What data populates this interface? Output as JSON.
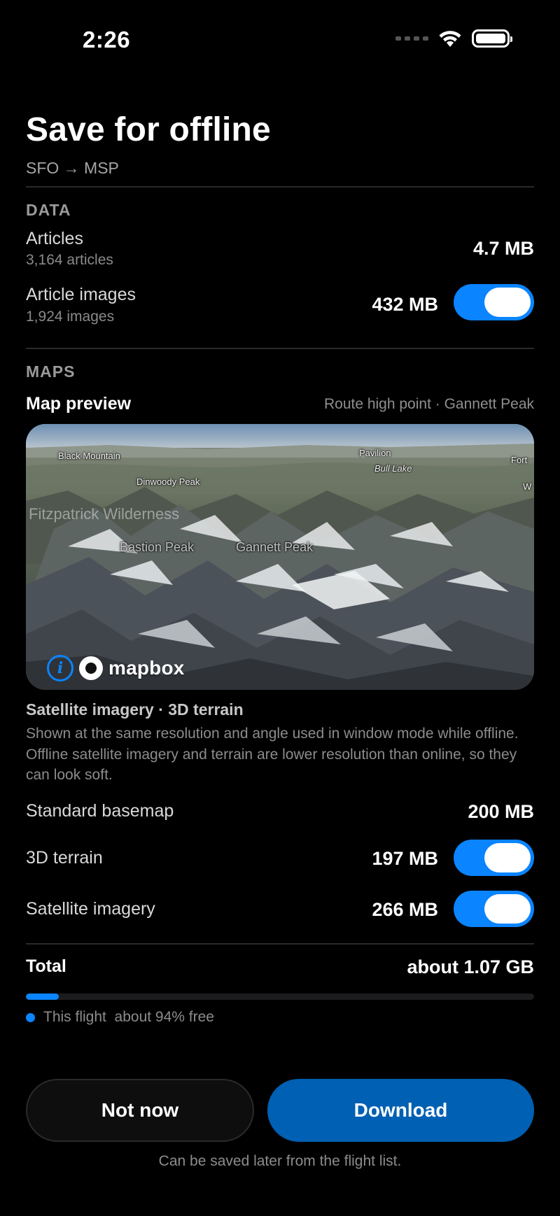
{
  "status_bar": {
    "time": "2:26",
    "icons": [
      "cellular-signal-icon",
      "wifi-icon",
      "battery-icon"
    ]
  },
  "header": {
    "title": "Save for offline",
    "route": "SFO → MSP"
  },
  "data_section": {
    "label": "DATA",
    "articles": {
      "title": "Articles",
      "subtitle": "3,164 articles",
      "size": "4.7 MB"
    },
    "article_images": {
      "title": "Article images",
      "subtitle": "1,924 images",
      "size": "432 MB",
      "enabled": true
    }
  },
  "maps_section": {
    "label": "MAPS",
    "preview_label": "Map preview",
    "preview_caption": "Route high point · Gannett Peak",
    "map_labels": {
      "black_mountain": "Black Mountain",
      "pavilion": "Pavilion",
      "bull_lake": "Bull Lake",
      "fort": "Fort",
      "dinwoody_peak": "Dinwoody Peak",
      "fitzpatrick": "Fitzpatrick Wilderness",
      "bastion_peak": "Bastion Peak",
      "gannett_peak": "Gannett Peak",
      "w": "W"
    },
    "attribution": {
      "brand": "mapbox",
      "info_icon": "info-icon"
    },
    "imagery_title": "Satellite imagery · 3D terrain",
    "imagery_description": "Shown at the same resolution and angle used in window mode while offline. Offline satellite imagery and terrain are lower resolution than online, so they can look soft.",
    "standard_basemap": {
      "title": "Standard basemap",
      "size": "200 MB"
    },
    "terrain_3d": {
      "title": "3D terrain",
      "size": "197 MB",
      "enabled": true
    },
    "satellite_imagery": {
      "title": "Satellite imagery",
      "size": "266 MB",
      "enabled": true
    }
  },
  "total": {
    "label": "Total",
    "value": "about 1.07 GB",
    "storage_used_fraction": 0.065,
    "legend": "This flight  about 94% free"
  },
  "actions": {
    "not_now": "Not now",
    "download": "Download",
    "footnote": "Can be saved later from the flight list."
  },
  "colors": {
    "accent": "#0a84ff",
    "primary_button": "#0060b3",
    "background": "#000000"
  }
}
